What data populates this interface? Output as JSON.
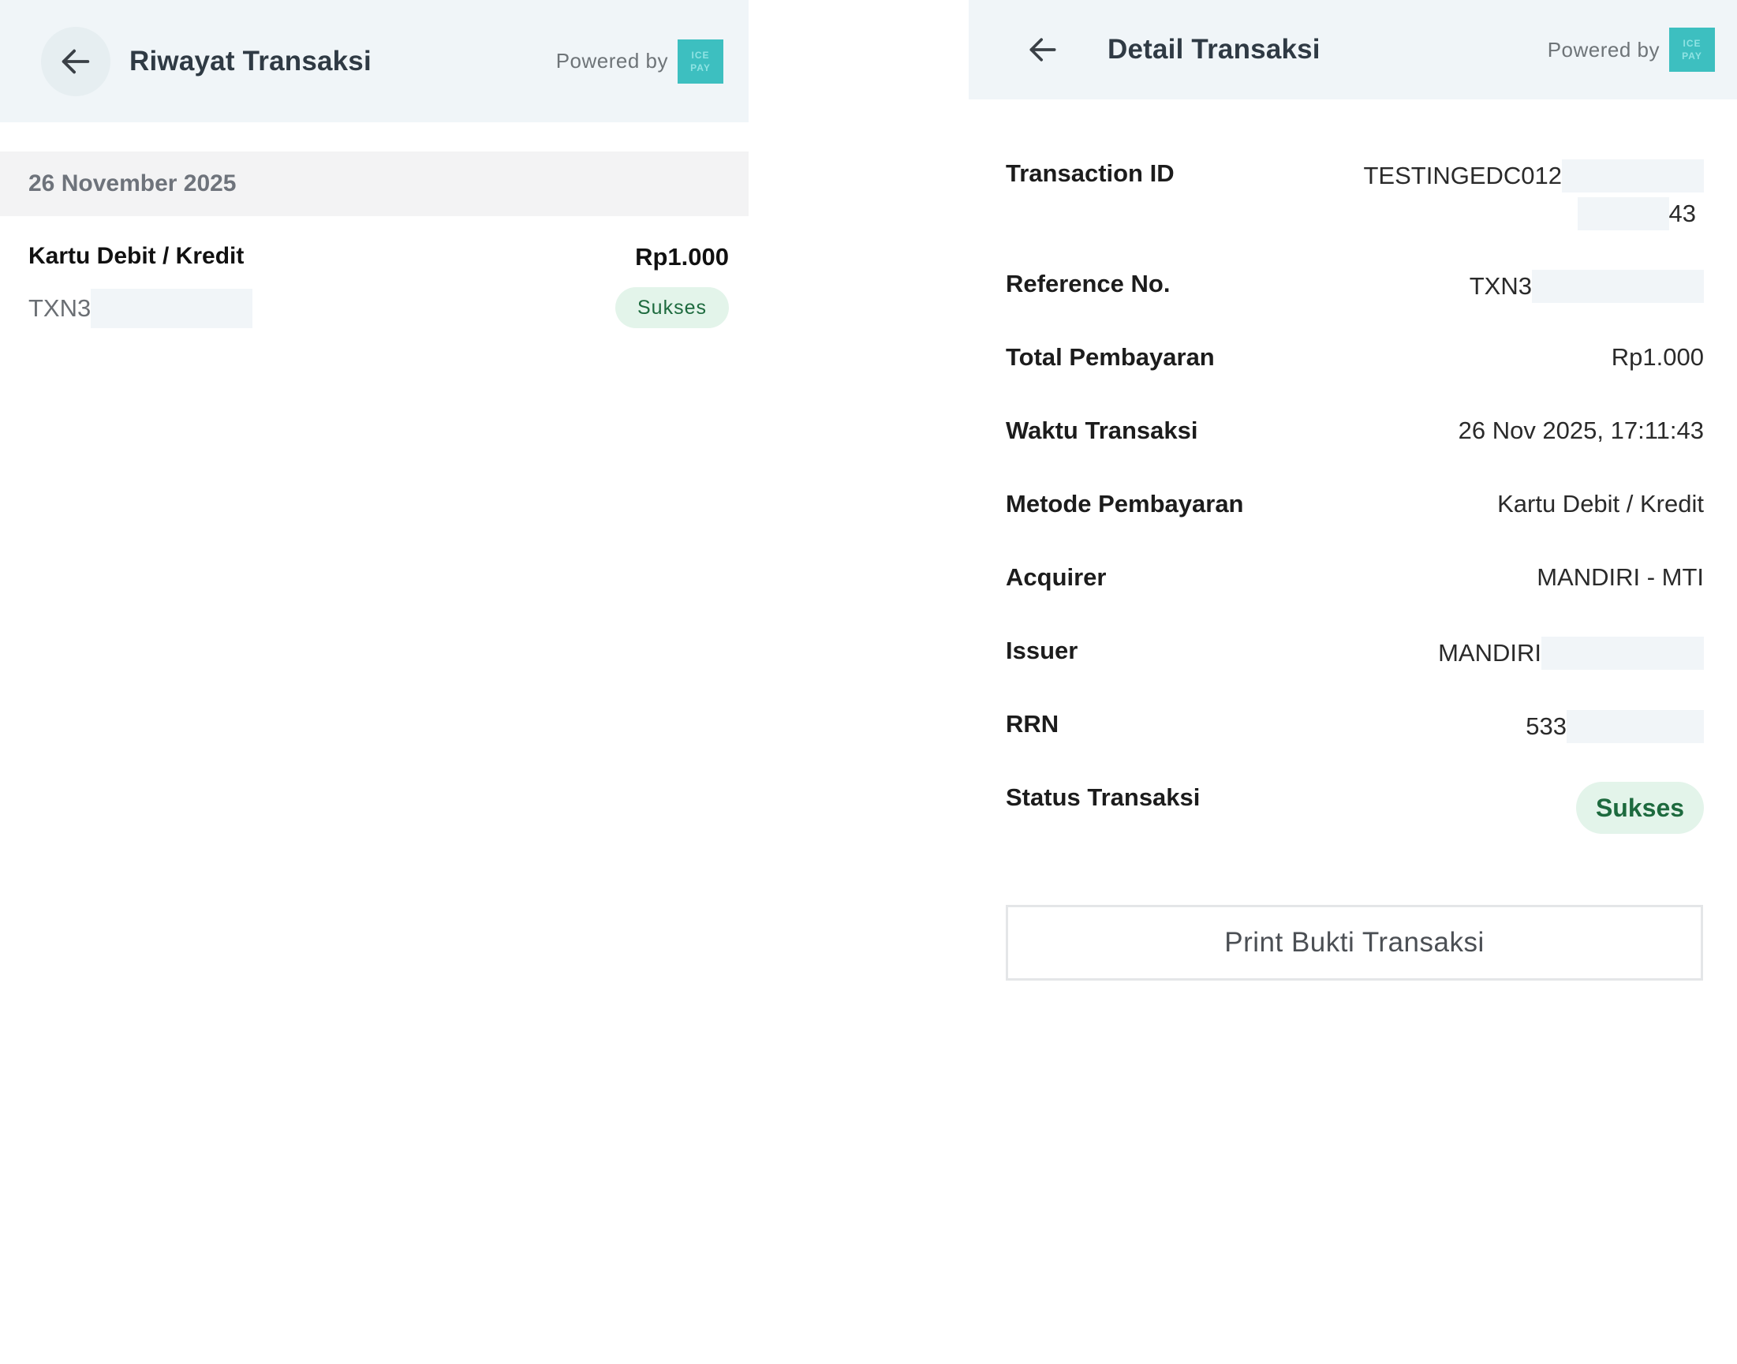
{
  "left_screen": {
    "header": {
      "title": "Riwayat Transaksi",
      "powered_by": "Powered by",
      "logo_text_top": "ICE",
      "logo_text_bottom": "PAY",
      "back_icon": "arrow-left-icon"
    },
    "date_group": "26 November 2025",
    "transaction": {
      "method": "Kartu Debit / Kredit",
      "amount": "Rp1.000",
      "reference": "TXN3",
      "status": "Sukses"
    }
  },
  "right_screen": {
    "header": {
      "title": "Detail Transaksi",
      "powered_by": "Powered by",
      "logo_text_top": "ICE",
      "logo_text_bottom": "PAY",
      "back_icon": "arrow-left-icon"
    },
    "details": {
      "transaction_id": {
        "label": "Transaction ID",
        "value_line1": "TESTINGEDC012",
        "value_line2": "43"
      },
      "reference_no": {
        "label": "Reference No.",
        "value": "TXN3"
      },
      "total": {
        "label": "Total Pembayaran",
        "value": "Rp1.000"
      },
      "time": {
        "label": "Waktu Transaksi",
        "value": "26 Nov 2025, 17:11:43"
      },
      "method": {
        "label": "Metode Pembayaran",
        "value": "Kartu Debit / Kredit"
      },
      "acquirer": {
        "label": "Acquirer",
        "value": "MANDIRI - MTI"
      },
      "issuer": {
        "label": "Issuer",
        "value": "MANDIRI"
      },
      "rrn": {
        "label": "RRN",
        "value": "533"
      },
      "status": {
        "label": "Status Transaksi",
        "value": "Sukses"
      }
    },
    "print_button": "Print Bukti Transaksi"
  },
  "colors": {
    "header_bg": "#f0f5f8",
    "success_bg": "#e3f4ea",
    "success_text": "#1d6a3e",
    "logo_bg": "#3dbfc0",
    "mask": "#f1f5f8"
  }
}
